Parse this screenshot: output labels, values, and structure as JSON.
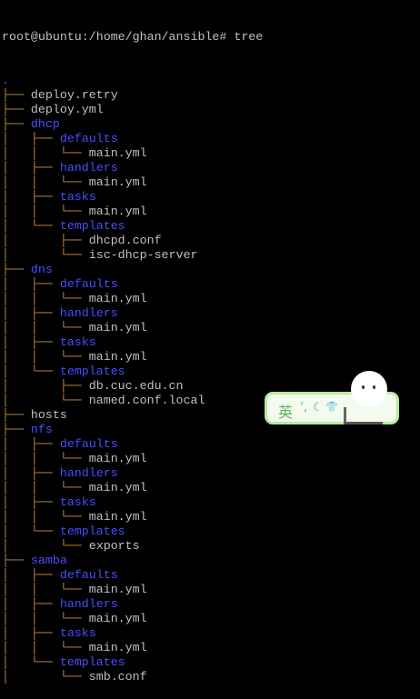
{
  "terminal": {
    "prompt": "root@ubuntu:/home/ghan/ansible# tree",
    "lines": [
      {
        "prefix": "",
        "name": ".",
        "type": "dir"
      },
      {
        "prefix": "├── ",
        "name": "deploy.retry",
        "type": "file"
      },
      {
        "prefix": "├── ",
        "name": "deploy.yml",
        "type": "file"
      },
      {
        "prefix": "├── ",
        "name": "dhcp",
        "type": "dir"
      },
      {
        "prefix": "│   ├── ",
        "name": "defaults",
        "type": "dir"
      },
      {
        "prefix": "│   │   └── ",
        "name": "main.yml",
        "type": "file"
      },
      {
        "prefix": "│   ├── ",
        "name": "handlers",
        "type": "dir"
      },
      {
        "prefix": "│   │   └── ",
        "name": "main.yml",
        "type": "file"
      },
      {
        "prefix": "│   ├── ",
        "name": "tasks",
        "type": "dir"
      },
      {
        "prefix": "│   │   └── ",
        "name": "main.yml",
        "type": "file"
      },
      {
        "prefix": "│   └── ",
        "name": "templates",
        "type": "dir"
      },
      {
        "prefix": "│       ├── ",
        "name": "dhcpd.conf",
        "type": "file"
      },
      {
        "prefix": "│       └── ",
        "name": "isc-dhcp-server",
        "type": "file"
      },
      {
        "prefix": "├── ",
        "name": "dns",
        "type": "dir"
      },
      {
        "prefix": "│   ├── ",
        "name": "defaults",
        "type": "dir"
      },
      {
        "prefix": "│   │   └── ",
        "name": "main.yml",
        "type": "file"
      },
      {
        "prefix": "│   ├── ",
        "name": "handlers",
        "type": "dir"
      },
      {
        "prefix": "│   │   └── ",
        "name": "main.yml",
        "type": "file"
      },
      {
        "prefix": "│   ├── ",
        "name": "tasks",
        "type": "dir"
      },
      {
        "prefix": "│   │   └── ",
        "name": "main.yml",
        "type": "file"
      },
      {
        "prefix": "│   └── ",
        "name": "templates",
        "type": "dir"
      },
      {
        "prefix": "│       ├── ",
        "name": "db.cuc.edu.cn",
        "type": "file"
      },
      {
        "prefix": "│       └── ",
        "name": "named.conf.local",
        "type": "file"
      },
      {
        "prefix": "├── ",
        "name": "hosts",
        "type": "file"
      },
      {
        "prefix": "├── ",
        "name": "nfs",
        "type": "dir"
      },
      {
        "prefix": "│   ├── ",
        "name": "defaults",
        "type": "dir"
      },
      {
        "prefix": "│   │   └── ",
        "name": "main.yml",
        "type": "file"
      },
      {
        "prefix": "│   ├── ",
        "name": "handlers",
        "type": "dir"
      },
      {
        "prefix": "│   │   └── ",
        "name": "main.yml",
        "type": "file"
      },
      {
        "prefix": "│   ├── ",
        "name": "tasks",
        "type": "dir"
      },
      {
        "prefix": "│   │   └── ",
        "name": "main.yml",
        "type": "file"
      },
      {
        "prefix": "│   └── ",
        "name": "templates",
        "type": "dir"
      },
      {
        "prefix": "│       └── ",
        "name": "exports",
        "type": "file"
      },
      {
        "prefix": "├── ",
        "name": "samba",
        "type": "dir"
      },
      {
        "prefix": "│   ├── ",
        "name": "defaults",
        "type": "dir"
      },
      {
        "prefix": "│   │   └── ",
        "name": "main.yml",
        "type": "file"
      },
      {
        "prefix": "│   ├── ",
        "name": "handlers",
        "type": "dir"
      },
      {
        "prefix": "│   │   └── ",
        "name": "main.yml",
        "type": "file"
      },
      {
        "prefix": "│   ├── ",
        "name": "tasks",
        "type": "dir"
      },
      {
        "prefix": "│   │   └── ",
        "name": "main.yml",
        "type": "file"
      },
      {
        "prefix": "│   └── ",
        "name": "templates",
        "type": "dir"
      },
      {
        "prefix": "│       └── ",
        "name": "smb.conf",
        "type": "file"
      }
    ]
  },
  "ime_toolbar": {
    "language": "英",
    "punct_icon": "ʼ,",
    "moon_icon": "☾",
    "shirt_icon": "👕"
  },
  "colors": {
    "dir": "#4c4cff",
    "file": "#c0c0c0",
    "tree": "#c8883c",
    "background": "#000000"
  }
}
